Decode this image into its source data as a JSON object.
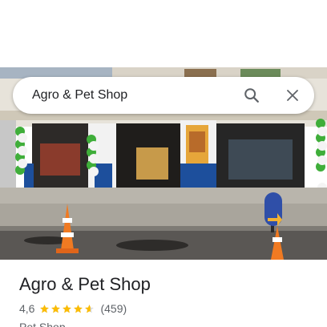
{
  "search": {
    "query": "Agro & Pet Shop"
  },
  "place": {
    "name": "Agro & Pet Shop",
    "rating": "4,6",
    "rating_value": 4.6,
    "review_count": "(459)",
    "category": "Pet Shop"
  },
  "icons": {
    "search": "search-icon",
    "close": "close-icon",
    "star": "star-icon"
  },
  "colors": {
    "star": "#fbbc04",
    "title": "#202124",
    "secondary": "#5f6368",
    "awning_blue": "#1d4f9c"
  }
}
